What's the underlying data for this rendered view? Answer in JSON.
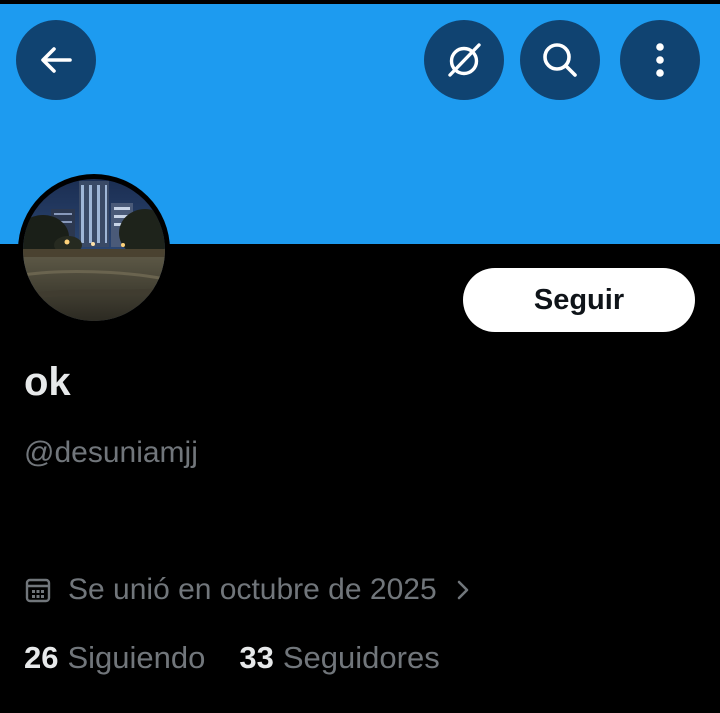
{
  "header": {
    "banner_color": "#1d9bf0",
    "buttons": [
      {
        "name": "back",
        "icon": "arrow-left-icon"
      },
      {
        "name": "grok",
        "icon": "grok-icon"
      },
      {
        "name": "search",
        "icon": "search-icon"
      },
      {
        "name": "more",
        "icon": "more-vertical-icon"
      }
    ]
  },
  "profile": {
    "avatar_icon": "city-night-photo",
    "display_name": "ok",
    "handle": "@desuniamjj",
    "follow_label": "Seguir",
    "joined_text": "Se unió en octubre de 2025",
    "following_count": "26",
    "following_label": "Siguiendo",
    "followers_count": "33",
    "followers_label": "Seguidores"
  }
}
